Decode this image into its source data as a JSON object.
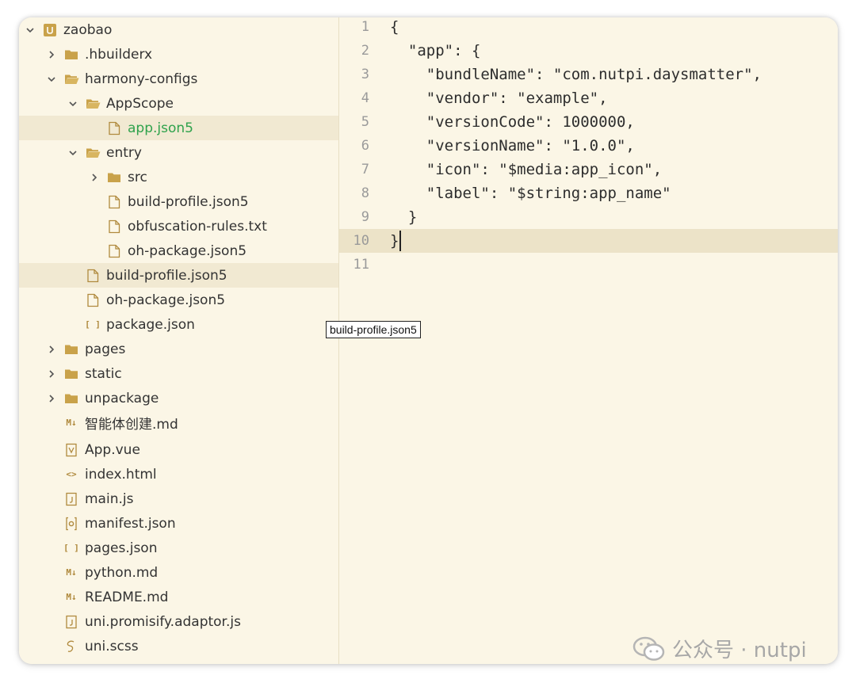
{
  "tree": [
    {
      "label": "zaobao",
      "indent": 0,
      "chevron": "down",
      "icon": "project"
    },
    {
      "label": ".hbuilderx",
      "indent": 1,
      "chevron": "right",
      "icon": "folder"
    },
    {
      "label": "harmony-configs",
      "indent": 1,
      "chevron": "down",
      "icon": "folder-open"
    },
    {
      "label": "AppScope",
      "indent": 2,
      "chevron": "down",
      "icon": "folder-open"
    },
    {
      "label": "app.json5",
      "indent": 3,
      "chevron": "none",
      "icon": "file",
      "state": "selected"
    },
    {
      "label": "entry",
      "indent": 2,
      "chevron": "down",
      "icon": "folder-open"
    },
    {
      "label": "src",
      "indent": 3,
      "chevron": "right",
      "icon": "folder"
    },
    {
      "label": "build-profile.json5",
      "indent": 3,
      "chevron": "none",
      "icon": "file"
    },
    {
      "label": "obfuscation-rules.txt",
      "indent": 3,
      "chevron": "none",
      "icon": "file"
    },
    {
      "label": "oh-package.json5",
      "indent": 3,
      "chevron": "none",
      "icon": "file"
    },
    {
      "label": "build-profile.json5",
      "indent": 2,
      "chevron": "none",
      "icon": "file",
      "state": "hover"
    },
    {
      "label": "oh-package.json5",
      "indent": 2,
      "chevron": "none",
      "icon": "file"
    },
    {
      "label": "package.json",
      "indent": 2,
      "chevron": "none",
      "icon": "brackets"
    },
    {
      "label": "pages",
      "indent": 1,
      "chevron": "right",
      "icon": "folder"
    },
    {
      "label": "static",
      "indent": 1,
      "chevron": "right",
      "icon": "folder"
    },
    {
      "label": "unpackage",
      "indent": 1,
      "chevron": "right",
      "icon": "folder"
    },
    {
      "label": "智能体创建.md",
      "indent": 1,
      "chevron": "none",
      "icon": "markdown"
    },
    {
      "label": "App.vue",
      "indent": 1,
      "chevron": "none",
      "icon": "vue"
    },
    {
      "label": "index.html",
      "indent": 1,
      "chevron": "none",
      "icon": "html"
    },
    {
      "label": "main.js",
      "indent": 1,
      "chevron": "none",
      "icon": "js"
    },
    {
      "label": "manifest.json",
      "indent": 1,
      "chevron": "none",
      "icon": "gear-file"
    },
    {
      "label": "pages.json",
      "indent": 1,
      "chevron": "none",
      "icon": "brackets"
    },
    {
      "label": "python.md",
      "indent": 1,
      "chevron": "none",
      "icon": "markdown"
    },
    {
      "label": "README.md",
      "indent": 1,
      "chevron": "none",
      "icon": "markdown"
    },
    {
      "label": "uni.promisify.adaptor.js",
      "indent": 1,
      "chevron": "none",
      "icon": "js"
    },
    {
      "label": "uni.scss",
      "indent": 1,
      "chevron": "none",
      "icon": "sass"
    }
  ],
  "editor": {
    "lines": [
      {
        "num": "1",
        "text": "{"
      },
      {
        "num": "2",
        "text": "  \"app\": {"
      },
      {
        "num": "3",
        "text": "    \"bundleName\": \"com.nutpi.daysmatter\","
      },
      {
        "num": "4",
        "text": "    \"vendor\": \"example\","
      },
      {
        "num": "5",
        "text": "    \"versionCode\": 1000000,"
      },
      {
        "num": "6",
        "text": "    \"versionName\": \"1.0.0\","
      },
      {
        "num": "7",
        "text": "    \"icon\": \"$media:app_icon\","
      },
      {
        "num": "8",
        "text": "    \"label\": \"$string:app_name\""
      },
      {
        "num": "9",
        "text": "  }"
      },
      {
        "num": "10",
        "text": "}",
        "current": true
      },
      {
        "num": "11",
        "text": ""
      }
    ]
  },
  "tooltip": {
    "text": "build-profile.json5"
  },
  "watermark": {
    "text": "公众号 · nutpi"
  },
  "colors": {
    "accent_selected": "#2fa24c",
    "folder": "#c9a24a",
    "background": "#fbf6e6"
  }
}
